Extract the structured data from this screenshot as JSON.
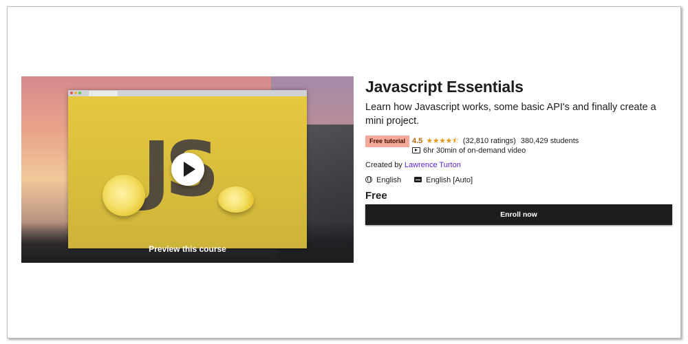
{
  "course": {
    "title": "Javascript Essentials",
    "subtitle": "Learn how Javascript works, some basic API's and finally create a mini project.",
    "badge": "Free tutorial",
    "rating": "4.5",
    "rating_value": 4.5,
    "stars": "★★★★⯪",
    "ratings_count": "(32,810 ratings)",
    "students": "380,429 students",
    "video_length": "6hr 30min of on-demand video",
    "created_by_label": "Created by",
    "author": "Lawrence Turton",
    "language": "English",
    "captions": "English [Auto]",
    "price": "Free",
    "enroll_label": "Enroll now"
  },
  "preview": {
    "label": "Preview this course",
    "thumbnail_text": "JS"
  },
  "colors": {
    "badge_bg": "#f5a99a",
    "rating": "#b4690e",
    "stars": "#e59819",
    "author_link": "#5624d0",
    "enroll_bg": "#1c1d1f"
  },
  "icons": [
    "play-icon",
    "video-icon",
    "globe-icon",
    "captions-icon",
    "star-icon"
  ]
}
